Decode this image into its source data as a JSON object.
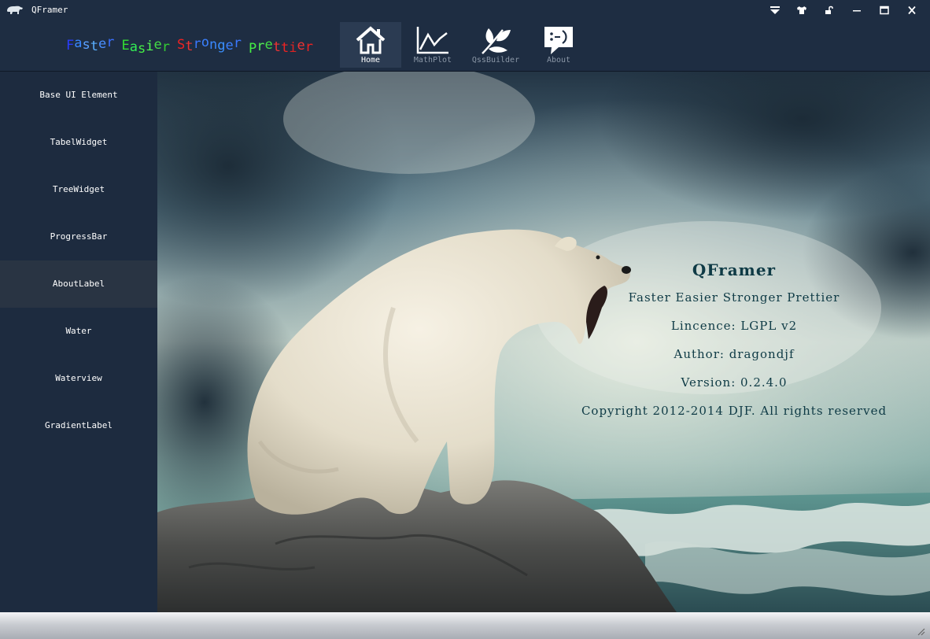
{
  "window": {
    "title": "QFramer",
    "controls": [
      "menu-icon",
      "skin-icon",
      "lock-icon",
      "minimize-icon",
      "maximize-icon",
      "close-icon"
    ]
  },
  "header": {
    "slogan_words": [
      {
        "text": "Faster",
        "colors": [
          "#2a3cff",
          "#3a88ff",
          "#5aa0ff",
          "#5ab0ff",
          "#4a90ff",
          "#3a70ff"
        ]
      },
      {
        "text": "Easier",
        "colors": [
          "#33dd33",
          "#33ee55",
          "#44ee44",
          "#55ff55",
          "#44dd44",
          "#33cc33"
        ]
      },
      {
        "text": "Stronger",
        "colors": [
          "#ee2222",
          "#ee3333",
          "#3a78ff",
          "#3a80ff",
          "#3a88ff",
          "#3a90ff",
          "#3a80ff",
          "#3a78ff"
        ]
      },
      {
        "text": "Prettier",
        "colors": [
          "#44ee44",
          "#55ee55",
          "#44dd44",
          "#ee3333",
          "#ee2222",
          "#dd2222",
          "#ee3333",
          "#ee2222"
        ]
      }
    ],
    "nav": [
      {
        "label": "Home",
        "icon": "home-icon",
        "active": true
      },
      {
        "label": "MathPlot",
        "icon": "chart-line-icon",
        "active": false
      },
      {
        "label": "QssBuilder",
        "icon": "leaf-icon",
        "active": false
      },
      {
        "label": "About",
        "icon": "speech-bubble-icon",
        "active": false
      }
    ]
  },
  "sidebar": {
    "items": [
      {
        "label": "Base UI Element",
        "active": false
      },
      {
        "label": "TabelWidget",
        "active": false
      },
      {
        "label": "TreeWidget",
        "active": false
      },
      {
        "label": "ProgressBar",
        "active": false
      },
      {
        "label": "AboutLabel",
        "active": true
      },
      {
        "label": "Water",
        "active": false
      },
      {
        "label": "Waterview",
        "active": false
      },
      {
        "label": "GradientLabel",
        "active": false
      }
    ]
  },
  "about": {
    "title": "QFramer",
    "slogan": "Faster Easier Stronger Prettier",
    "licence": "Lincence: LGPL v2",
    "author": "Author: dragondjf",
    "version": "Version: 0.2.4.0",
    "copyright": "Copyright 2012-2014 DJF. All rights reserved"
  },
  "colors": {
    "chrome_bg": "#1e2d42",
    "sidebar_bg": "#1d2b3f",
    "sidebar_active": "#293443",
    "about_text": "#0e3a45"
  }
}
